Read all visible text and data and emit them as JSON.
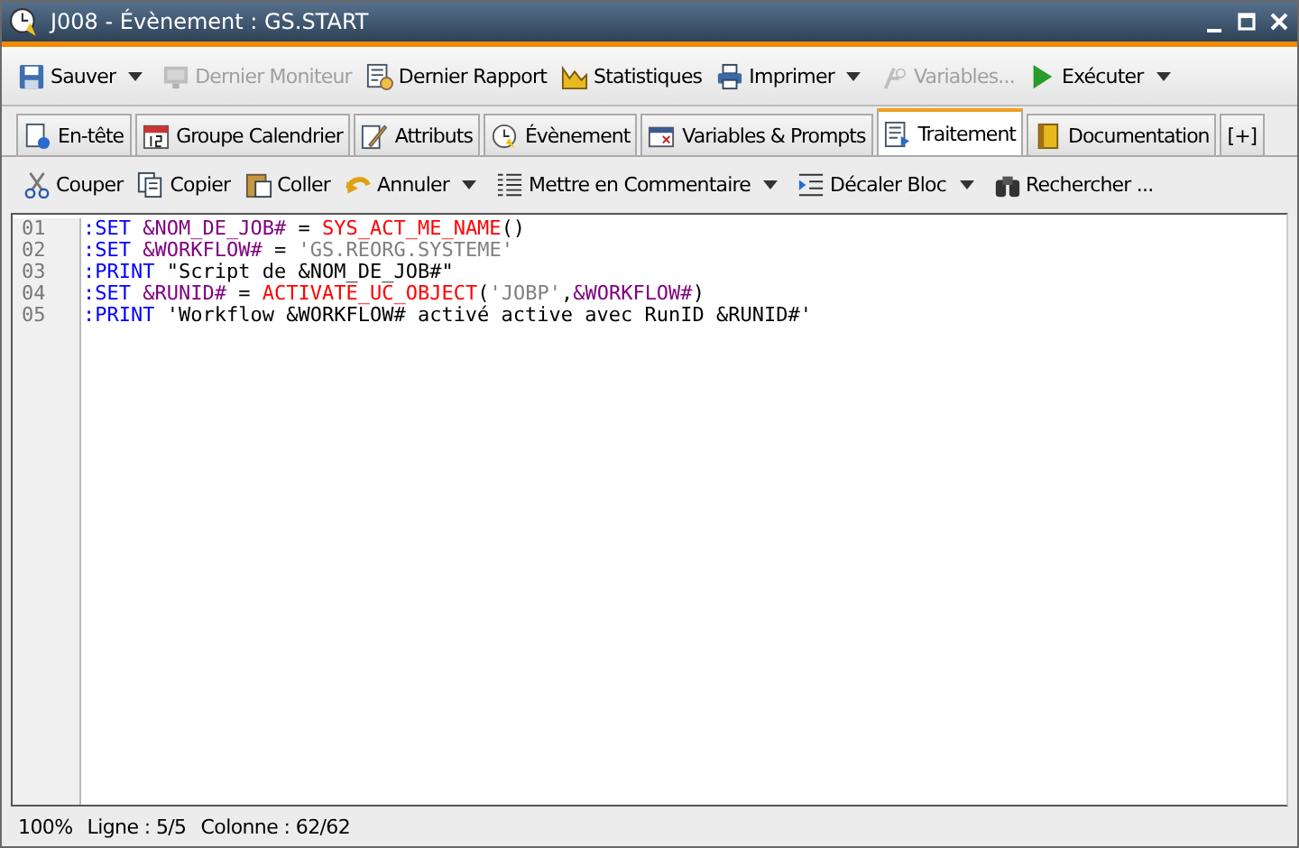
{
  "window": {
    "title": "J008 - Évènement : GS.START"
  },
  "toolbar": [
    {
      "label": "Sauver",
      "disabled": false,
      "dropdown": true
    },
    {
      "label": "Dernier Moniteur",
      "disabled": true,
      "dropdown": false
    },
    {
      "label": "Dernier Rapport",
      "disabled": false,
      "dropdown": false
    },
    {
      "label": "Statistiques",
      "disabled": false,
      "dropdown": false
    },
    {
      "label": "Imprimer",
      "disabled": false,
      "dropdown": true
    },
    {
      "label": "Variables...",
      "disabled": true,
      "dropdown": false
    },
    {
      "label": "Exécuter",
      "disabled": false,
      "dropdown": true
    }
  ],
  "tabs": [
    {
      "label": "En-tête",
      "selected": false
    },
    {
      "label": "Groupe Calendrier",
      "selected": false
    },
    {
      "label": "Attributs",
      "selected": false
    },
    {
      "label": "Évènement",
      "selected": false
    },
    {
      "label": "Variables & Prompts",
      "selected": false
    },
    {
      "label": "Traitement",
      "selected": true
    },
    {
      "label": "Documentation",
      "selected": false
    },
    {
      "label": "[+]",
      "selected": false
    }
  ],
  "edit_toolbar": [
    {
      "label": "Couper",
      "dropdown": false
    },
    {
      "label": "Copier",
      "dropdown": false
    },
    {
      "label": "Coller",
      "dropdown": false
    },
    {
      "label": "Annuler",
      "dropdown": true
    },
    {
      "label": "Mettre en Commentaire",
      "dropdown": true
    },
    {
      "label": "Décaler Bloc",
      "dropdown": true
    },
    {
      "label": "Rechercher ...",
      "dropdown": false
    }
  ],
  "editor": {
    "lines": [
      {
        "number": "01",
        "tokens": [
          {
            "kind": "kw",
            "text": ":SET"
          },
          {
            "kind": "var",
            "text": " &NOM_DE_JOB#"
          },
          {
            "kind": "txt",
            "text": " = "
          },
          {
            "kind": "fn",
            "text": "SYS_ACT_ME_NAME"
          },
          {
            "kind": "txt",
            "text": "()"
          }
        ]
      },
      {
        "number": "02",
        "tokens": [
          {
            "kind": "kw",
            "text": ":SET"
          },
          {
            "kind": "var",
            "text": " &WORKFLOW#"
          },
          {
            "kind": "txt",
            "text": " = "
          },
          {
            "kind": "str",
            "text": "'GS.REORG.SYSTEME'"
          }
        ]
      },
      {
        "number": "03",
        "tokens": [
          {
            "kind": "kw",
            "text": ":PRINT"
          },
          {
            "kind": "txt",
            "text": " \"Script de &NOM_DE_JOB#\""
          }
        ]
      },
      {
        "number": "04",
        "tokens": [
          {
            "kind": "kw",
            "text": ":SET"
          },
          {
            "kind": "var",
            "text": " &RUNID#"
          },
          {
            "kind": "txt",
            "text": " = "
          },
          {
            "kind": "fn",
            "text": "ACTIVATE_UC_OBJECT"
          },
          {
            "kind": "txt",
            "text": "("
          },
          {
            "kind": "str",
            "text": "'JOBP'"
          },
          {
            "kind": "txt",
            "text": ","
          },
          {
            "kind": "var",
            "text": "&WORKFLOW#"
          },
          {
            "kind": "txt",
            "text": ")"
          }
        ]
      },
      {
        "number": "05",
        "tokens": [
          {
            "kind": "kw",
            "text": ":PRINT"
          },
          {
            "kind": "txt",
            "text": " 'Workflow &WORKFLOW# activé active avec RunID &RUNID#'"
          }
        ]
      }
    ]
  },
  "status_bar": {
    "zoom": "100%",
    "line": "Ligne : 5/5",
    "column": "Colonne : 62/62"
  }
}
